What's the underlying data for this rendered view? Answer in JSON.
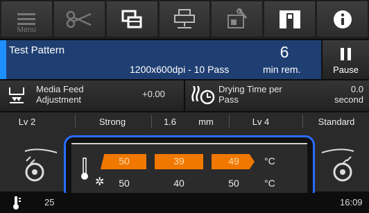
{
  "toolbar": {
    "menu_label": "Menu",
    "buttons": [
      "menu-icon",
      "scissors-icon",
      "layers-icon",
      "printer-icon",
      "maintenance-icon",
      "manual-icon",
      "info-icon"
    ]
  },
  "status": {
    "job_name": "Test Pattern",
    "job_info": "1200x600dpi - 10 Pass",
    "time_value": "6",
    "time_unit": "min rem.",
    "pause_label": "Pause",
    "accent": "#1e8fff"
  },
  "settings_row": {
    "media_feed": {
      "label_line1": "Media Feed",
      "label_line2": "Adjustment",
      "value": "+0.00"
    },
    "drying": {
      "label_line1": "Drying Time per",
      "label_line2": "Pass",
      "value_line1": "0.0",
      "value_line2": "second"
    }
  },
  "params_row": {
    "cells": [
      "Lv 2",
      "Strong",
      "1.6",
      "mm",
      "Lv 4",
      "Standard"
    ]
  },
  "temperature": {
    "current": [
      "50",
      "39",
      "49"
    ],
    "set": [
      "50",
      "40",
      "50"
    ],
    "unit_current": "°C",
    "unit_set": "°C",
    "bar_color": "#f07800"
  },
  "footer": {
    "ink_temp": "25",
    "time": "16:09"
  }
}
